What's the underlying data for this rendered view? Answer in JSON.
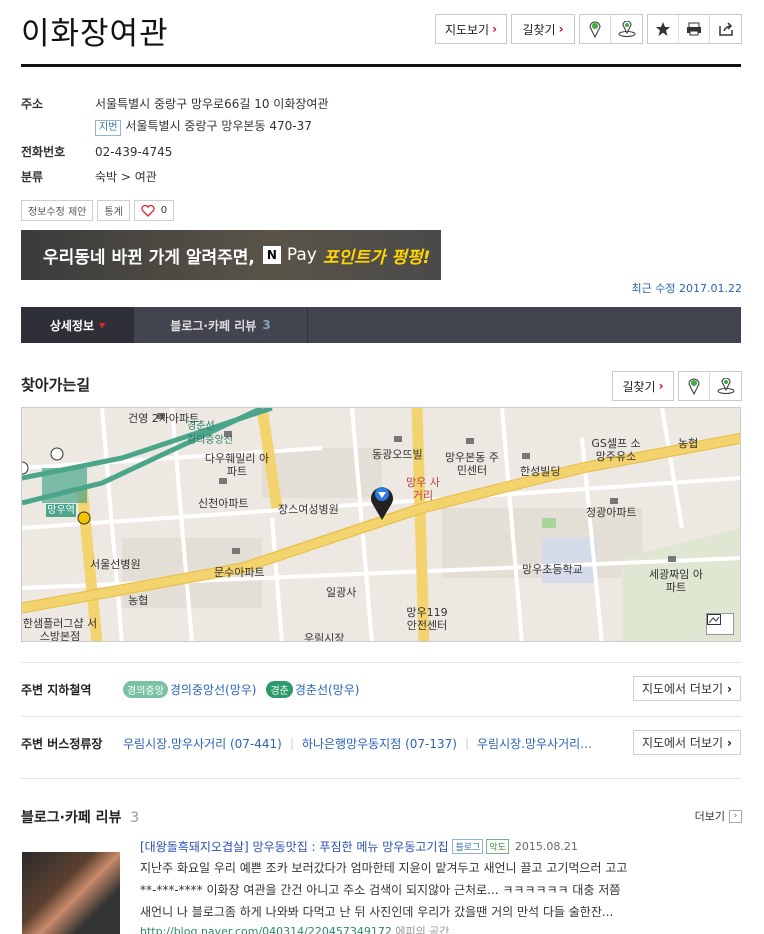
{
  "header": {
    "title": "이화장여관",
    "map_view": "지도보기",
    "directions": "길찾기"
  },
  "info": {
    "address_label": "주소",
    "address": "서울특별시 중랑구 망우로66길 10 이화장여관",
    "jibun_tag": "지번",
    "jibun_address": "서울특별시 중랑구 망우본동 470-37",
    "phone_label": "전화번호",
    "phone": "02-439-4745",
    "category_label": "분류",
    "category": "숙박 > 여관"
  },
  "actions": {
    "suggest_edit": "정보수정 제안",
    "stats": "통계",
    "like_count": "0"
  },
  "banner": {
    "text": "우리동네 바뀐 가게 알려주면,",
    "n": "N",
    "pay": "Pay",
    "highlight": "포인트가 펑펑!"
  },
  "recent_update": "최근 수정 2017.01.22",
  "tabs": {
    "detail": "상세정보",
    "blog": "블로그·카페 리뷰",
    "blog_count": "3"
  },
  "route": {
    "title": "찾아가는길",
    "directions": "길찾기"
  },
  "map_labels": {
    "l1": "건영 2차아파트",
    "l2": "다우훼밀리 아파트",
    "l3": "신천아파트",
    "l4": "동광오뜨빌",
    "l5": "망우본동 주민센터",
    "l6": "GS셀프 소망주유소",
    "l7": "농협",
    "l8": "한성빌딩",
    "l9": "청광아파트",
    "l10": "망우 사거리",
    "l11": "장스여성병원",
    "l12": "서울선병원",
    "l13": "문수아파트",
    "l14": "일광사",
    "l15": "망우초등학교",
    "l16": "세광짜임 아파트",
    "l17": "농협",
    "l18": "한샘플러그샵 서스방본점",
    "l19": "망우119 안전센터",
    "l20": "우림시장",
    "l21": "망우역",
    "l22": "경춘선",
    "l23": "경의중앙선"
  },
  "subway": {
    "label": "주변 지하철역",
    "line1_tag": "경의중앙",
    "line1_name": "경의중앙선(망우)",
    "line2_tag": "경춘",
    "line2_name": "경춘선(망우)",
    "more": "지도에서 더보기"
  },
  "bus": {
    "label": "주변 버스정류장",
    "stop1": "우림시장.망우사거리 (07-441)",
    "stop2": "하나은행망우동지점 (07-137)",
    "stop3": "우림시장.망우사거리…",
    "more": "지도에서 더보기"
  },
  "blog_section": {
    "title": "블로그·카페 리뷰",
    "count": "3",
    "more": "더보기",
    "entry_title": "[대왕돌흑돼지오겹살] 망우동맛집 : 푸짐한 메뉴 망우동고기집",
    "tag": "블로그",
    "author": "악도",
    "date": "2015.08.21",
    "line1": "지난주 화요일 우리 예쁜 조카 보러갔다가 엄마한테 지윤이 맡겨두고 새언니 끌고 고기먹으러 고고",
    "line2": "**-***-**** 이화장 여관을 간건 아니고 주소 검색이 되지않아 근처로... ㅋㅋㅋㅋㅋㅋ 대충 저쯤",
    "line3": "새언니 나 블로그좀 하게 나와봐 다먹고 난 뒤 사진인데 우리가 갔을땐 거의 만석 다들 술한잔...",
    "url": "http://blog.naver.com/040314/220457349172",
    "url_author": "에피의 공간"
  },
  "colors": {
    "accent_red": "#d0021b",
    "link_blue": "#2a63b7",
    "tab_bg": "#424450",
    "line_green": "#4aa58a"
  }
}
